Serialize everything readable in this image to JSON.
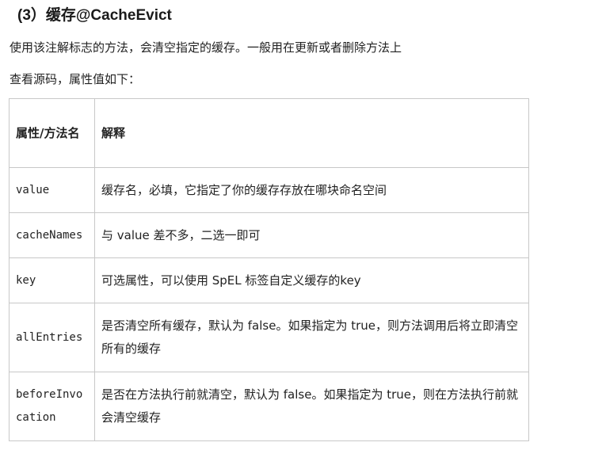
{
  "section": {
    "heading": "(3）缓存@CacheEvict",
    "intro": "使用该注解标志的方法，会清空指定的缓存。一般用在更新或者删除方法上",
    "source_note": "查看源码，属性值如下："
  },
  "table": {
    "headers": [
      "属性/方法名",
      "解释"
    ],
    "rows": [
      {
        "name": "value",
        "desc": "缓存名，必填，它指定了你的缓存存放在哪块命名空间"
      },
      {
        "name": "cacheNames",
        "desc": "与 value 差不多，二选一即可"
      },
      {
        "name": "key",
        "desc": "可选属性，可以使用 SpEL 标签自定义缓存的key"
      },
      {
        "name": "allEntries",
        "desc": "是否清空所有缓存，默认为 false。如果指定为 true，则方法调用后将立即清空所有的缓存"
      },
      {
        "name": "beforeInvocation",
        "desc": "是否在方法执行前就清空，默认为 false。如果指定为 true，则在方法执行前就会清空缓存"
      }
    ]
  }
}
